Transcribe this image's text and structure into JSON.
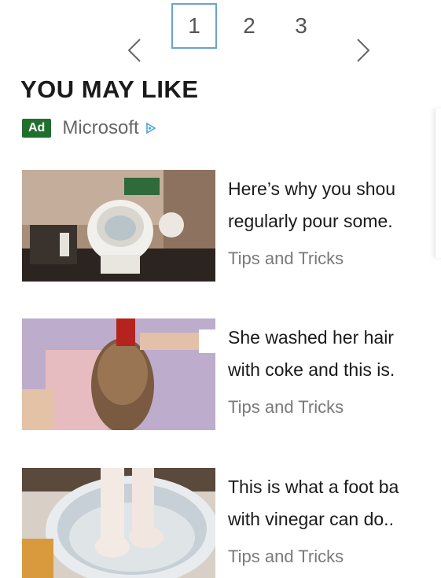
{
  "pagination": {
    "pages": [
      "1",
      "2",
      "3"
    ],
    "active_page": "1"
  },
  "section": {
    "title": "YOU MAY LIKE"
  },
  "sponsor": {
    "badge": "Ad",
    "name": "Microsoft",
    "icon": "adchoices-icon",
    "badge_color": "#1f6f2d"
  },
  "articles": [
    {
      "headline_line1": "Here’s why you shou",
      "headline_line2": "regularly pour some.",
      "category": "Tips and Tricks",
      "image": "toilet-thumbnail"
    },
    {
      "headline_line1": "She washed her hair",
      "headline_line2": "with coke and this is.",
      "category": "Tips and Tricks",
      "image": "hair-wash-thumbnail"
    },
    {
      "headline_line1": "This is what a foot ba",
      "headline_line2": "with vinegar can do..",
      "category": "Tips and Tricks",
      "image": "foot-bath-thumbnail"
    }
  ],
  "colors": {
    "pager_active_border": "#6aa3cf",
    "category_text": "#7a7a7a"
  }
}
